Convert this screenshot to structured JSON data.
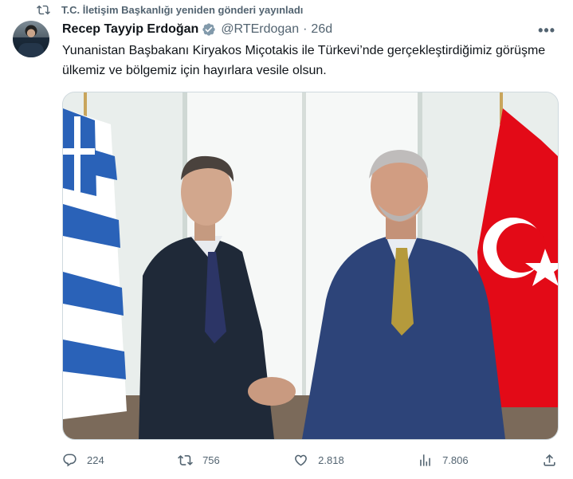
{
  "repost": {
    "text": "T.C. İletişim Başkanlığı yeniden gönderi yayınladı",
    "icon": "repost-icon"
  },
  "author": {
    "name": "Recep Tayyip Erdoğan",
    "handle": "@RTErdogan",
    "separator": "·",
    "time": "26d",
    "verified_color": "#829aab"
  },
  "tweet": {
    "text": "Yunanistan Başbakanı Kiryakos Miçotakis ile Türkevi’nde gerçekleştirdiğimiz görüşme ülkemiz ve bölgemiz için hayırlara vesile olsun."
  },
  "more_label": "•••",
  "actions": {
    "replies": "224",
    "reposts": "756",
    "likes": "2.818",
    "views": "7.806"
  },
  "colors": {
    "accent_gray": "#536471",
    "greek_flag_blue": "#2a62b8",
    "turkish_flag_red": "#e30a17"
  }
}
